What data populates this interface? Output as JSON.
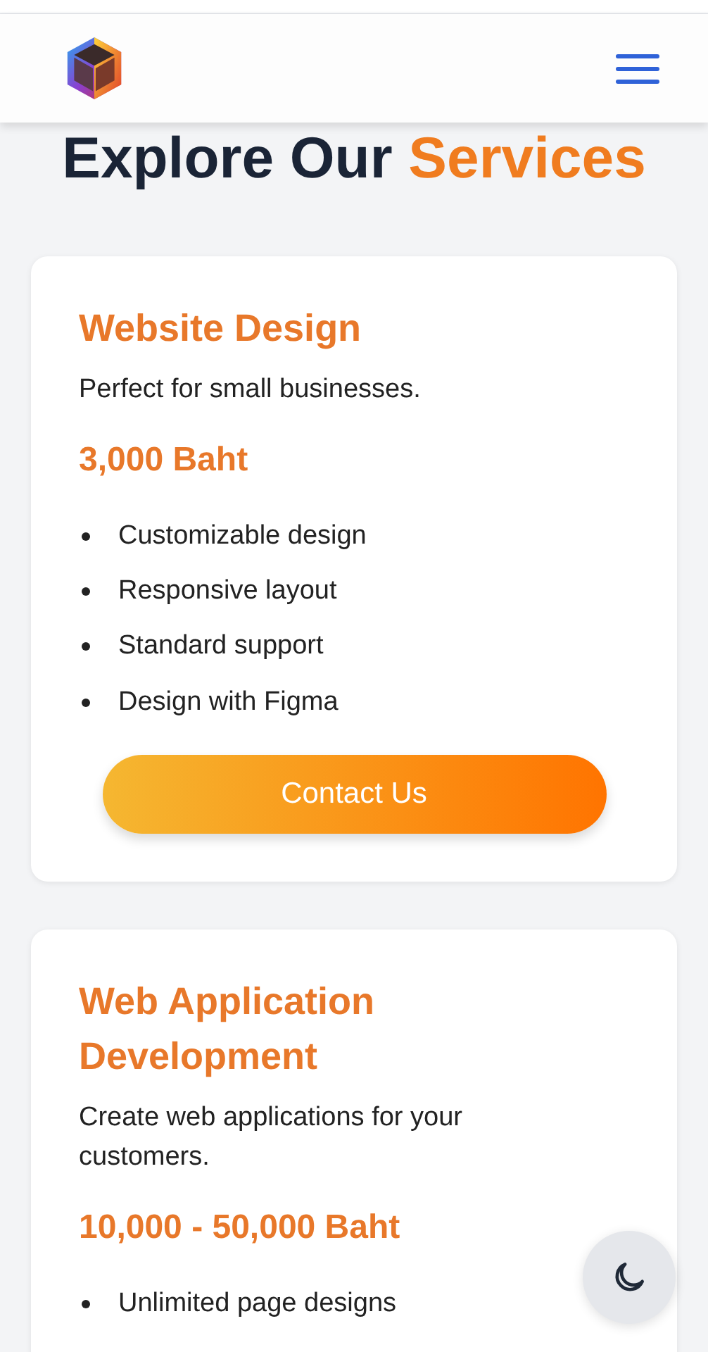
{
  "header": {
    "menu_open": false
  },
  "heading": {
    "lead": "Explore Our",
    "accent": "Services"
  },
  "cards": [
    {
      "title": "Website Design",
      "description": "Perfect for small businesses.",
      "price": "3,000 Baht",
      "features": [
        "Customizable design",
        "Responsive layout",
        "Standard support",
        "Design with Figma"
      ],
      "button": "Contact Us"
    },
    {
      "title": "Web Application Development",
      "description": "Create web applications for your customers.",
      "price": "10,000 - 50,000 Baht",
      "features": [
        "Unlimited page designs"
      ]
    }
  ],
  "theme_toggle": {
    "dark": false
  }
}
